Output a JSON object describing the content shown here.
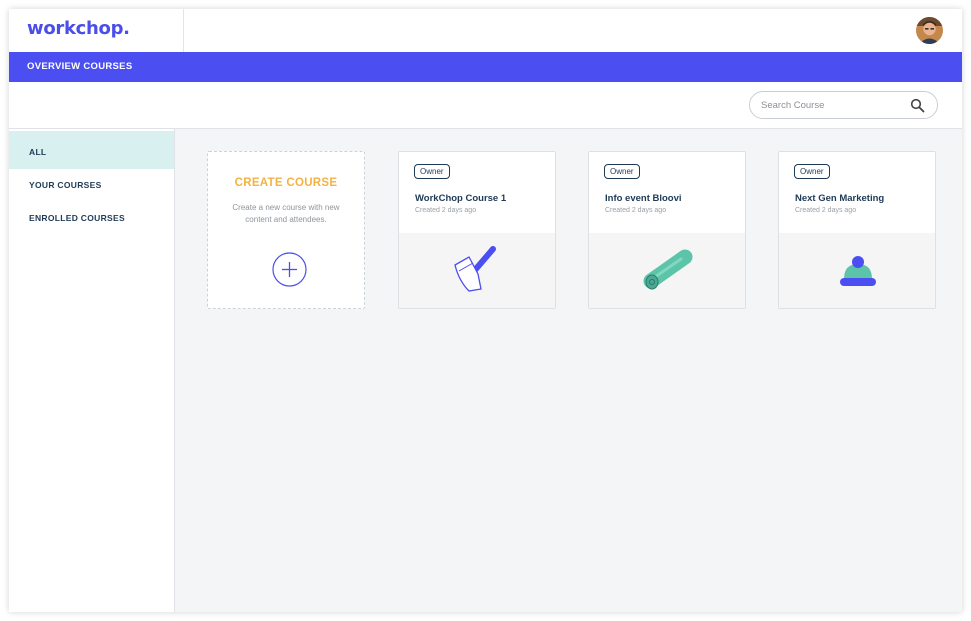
{
  "brand": {
    "logo_text": "workchop.",
    "accent": "#4b4ef0"
  },
  "header": {
    "avatar_icon": "user-avatar"
  },
  "titlebar": {
    "title": "OVERVIEW COURSES"
  },
  "search": {
    "placeholder": "Search Course",
    "value": "",
    "icon": "search-icon"
  },
  "sidebar": {
    "items": [
      {
        "label": "ALL",
        "active": true
      },
      {
        "label": "YOUR COURSES",
        "active": false
      },
      {
        "label": "ENROLLED COURSES",
        "active": false
      }
    ]
  },
  "create_card": {
    "title": "CREATE COURSE",
    "description": "Create a new course with new content and attendees.",
    "icon": "plus-circle-icon"
  },
  "courses": [
    {
      "badge": "Owner",
      "title": "WorkChop Course 1",
      "created": "Created 2 days ago",
      "icon": "axe-icon"
    },
    {
      "badge": "Owner",
      "title": "Info event Bloovi",
      "created": "Created 2 days ago",
      "icon": "log-icon"
    },
    {
      "badge": "Owner",
      "title": "Next Gen Marketing",
      "created": "Created 2 days ago",
      "icon": "beanie-icon"
    }
  ]
}
